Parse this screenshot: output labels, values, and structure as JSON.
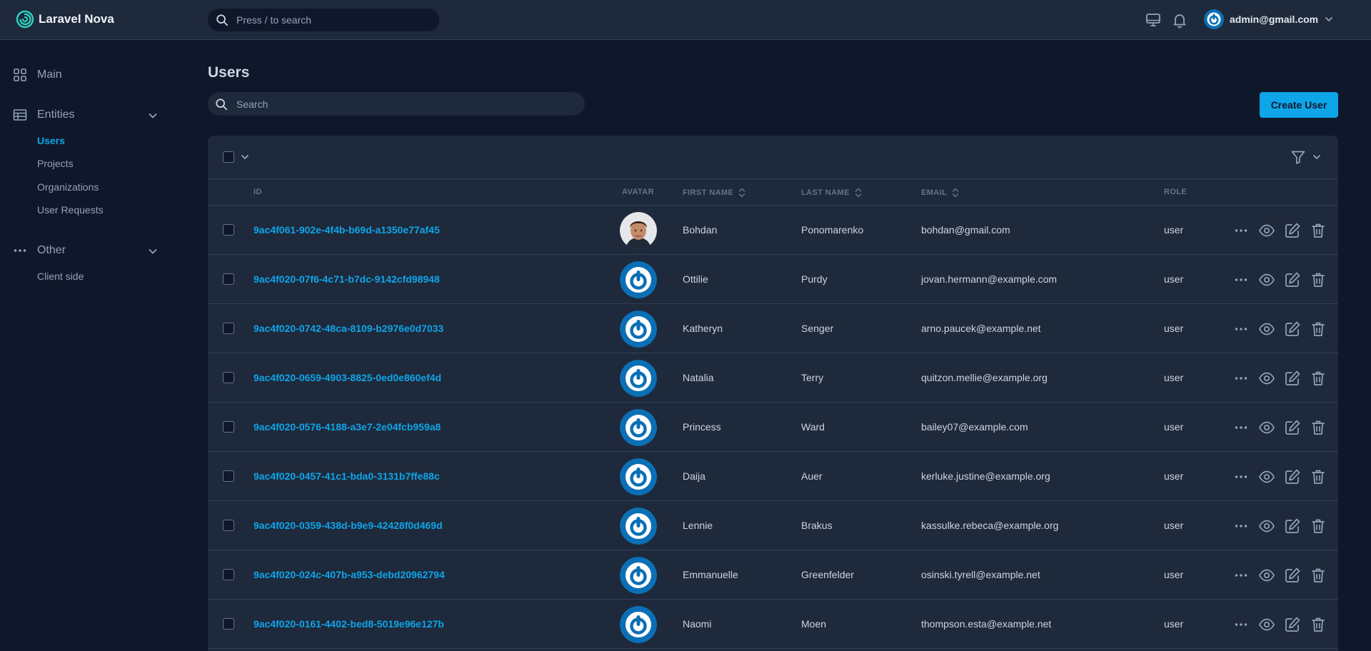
{
  "brand": {
    "name": "Laravel Nova"
  },
  "global_search": {
    "placeholder": "Press / to search"
  },
  "header": {
    "user_email": "admin@gmail.com"
  },
  "sidebar": {
    "main_label": "Main",
    "entities_label": "Entities",
    "entities_items": [
      "Users",
      "Projects",
      "Organizations",
      "User Requests"
    ],
    "other_label": "Other",
    "other_items": [
      "Client side"
    ]
  },
  "page": {
    "title": "Users",
    "search_placeholder": "Search",
    "create_label": "Create User"
  },
  "table": {
    "columns": {
      "id": "ID",
      "avatar": "AVATAR",
      "first_name": "FIRST NAME",
      "last_name": "LAST NAME",
      "email": "EMAIL",
      "role": "ROLE"
    },
    "rows": [
      {
        "id": "9ac4f061-902e-4f4b-b69d-a1350e77af45",
        "avatar": "photo",
        "first_name": "Bohdan",
        "last_name": "Ponomarenko",
        "email": "bohdan@gmail.com",
        "role": "user"
      },
      {
        "id": "9ac4f020-07f6-4c71-b7dc-9142cfd98948",
        "avatar": "default",
        "first_name": "Ottilie",
        "last_name": "Purdy",
        "email": "jovan.hermann@example.com",
        "role": "user"
      },
      {
        "id": "9ac4f020-0742-48ca-8109-b2976e0d7033",
        "avatar": "default",
        "first_name": "Katheryn",
        "last_name": "Senger",
        "email": "arno.paucek@example.net",
        "role": "user"
      },
      {
        "id": "9ac4f020-0659-4903-8825-0ed0e860ef4d",
        "avatar": "default",
        "first_name": "Natalia",
        "last_name": "Terry",
        "email": "quitzon.mellie@example.org",
        "role": "user"
      },
      {
        "id": "9ac4f020-0576-4188-a3e7-2e04fcb959a8",
        "avatar": "default",
        "first_name": "Princess",
        "last_name": "Ward",
        "email": "bailey07@example.com",
        "role": "user"
      },
      {
        "id": "9ac4f020-0457-41c1-bda0-3131b7ffe88c",
        "avatar": "default",
        "first_name": "Daija",
        "last_name": "Auer",
        "email": "kerluke.justine@example.org",
        "role": "user"
      },
      {
        "id": "9ac4f020-0359-438d-b9e9-42428f0d469d",
        "avatar": "default",
        "first_name": "Lennie",
        "last_name": "Brakus",
        "email": "kassulke.rebeca@example.org",
        "role": "user"
      },
      {
        "id": "9ac4f020-024c-407b-a953-debd20962794",
        "avatar": "default",
        "first_name": "Emmanuelle",
        "last_name": "Greenfelder",
        "email": "osinski.tyrell@example.net",
        "role": "user"
      },
      {
        "id": "9ac4f020-0161-4402-bed8-5019e96e127b",
        "avatar": "default",
        "first_name": "Naomi",
        "last_name": "Moen",
        "email": "thompson.esta@example.net",
        "role": "user"
      }
    ]
  },
  "icons": {
    "brand": "nova-spiral-icon",
    "search": "search-icon",
    "monitor": "monitor-icon",
    "bell": "bell-icon",
    "filter": "filter-icon",
    "more": "more-horizontal-icon",
    "view": "eye-icon",
    "edit": "edit-icon",
    "delete": "trash-icon"
  },
  "colors": {
    "accent": "#0ea5e9",
    "background": "#0f172a",
    "surface": "#1e293b",
    "border": "#334155",
    "avatar_blue": "#0b6fb5"
  }
}
